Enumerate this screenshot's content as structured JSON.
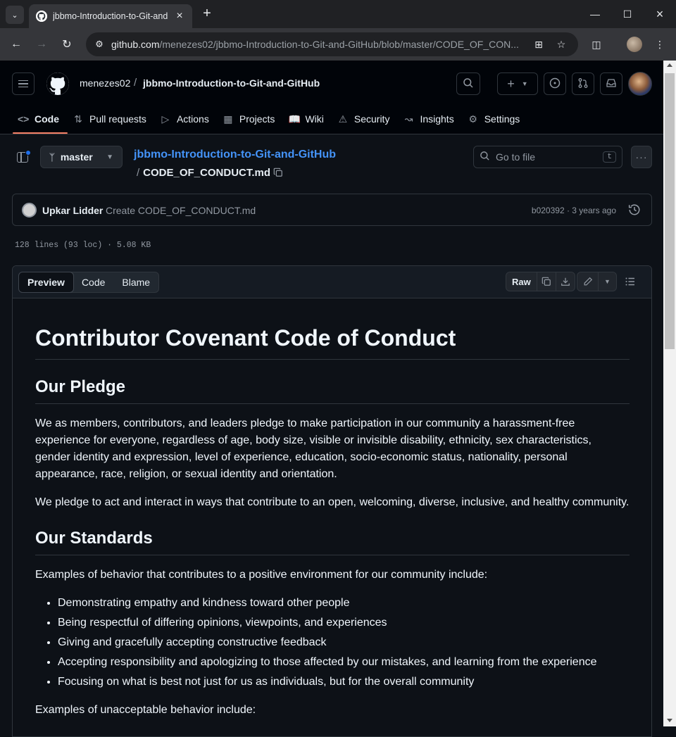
{
  "browser": {
    "tab_title": "jbbmo-Introduction-to-Git-and",
    "url_host": "github.com",
    "url_path": "/menezes02/jbbmo-Introduction-to-Git-and-GitHub/blob/master/CODE_OF_CON..."
  },
  "header": {
    "owner": "menezes02",
    "separator": "/",
    "repo": "jbbmo-Introduction-to-Git-and-GitHub"
  },
  "repo_nav": [
    {
      "label": "Code",
      "icon": "code-icon"
    },
    {
      "label": "Pull requests",
      "icon": "pull-request-icon"
    },
    {
      "label": "Actions",
      "icon": "actions-icon"
    },
    {
      "label": "Projects",
      "icon": "projects-icon"
    },
    {
      "label": "Wiki",
      "icon": "book-icon"
    },
    {
      "label": "Security",
      "icon": "shield-icon"
    },
    {
      "label": "Insights",
      "icon": "graph-icon"
    },
    {
      "label": "Settings",
      "icon": "gear-icon"
    }
  ],
  "file": {
    "branch": "master",
    "repo_link": "jbbmo-Introduction-to-Git-and-GitHub",
    "path_sep": "/",
    "filename": "CODE_OF_CONDUCT.md",
    "goto_placeholder": "Go to file",
    "goto_key": "t",
    "meta": "128 lines (93 loc) · 5.08 KB"
  },
  "commit": {
    "author": "Upkar Lidder",
    "message": "Create CODE_OF_CONDUCT.md",
    "sha_time": "b020392 · 3 years ago"
  },
  "viewer": {
    "tabs": [
      "Preview",
      "Code",
      "Blame"
    ],
    "raw_label": "Raw"
  },
  "content": {
    "h1": "Contributor Covenant Code of Conduct",
    "h2_pledge": "Our Pledge",
    "p1": "We as members, contributors, and leaders pledge to make participation in our community a harassment-free experience for everyone, regardless of age, body size, visible or invisible disability, ethnicity, sex characteristics, gender identity and expression, level of experience, education, socio-economic status, nationality, personal appearance, race, religion, or sexual identity and orientation.",
    "p2": "We pledge to act and interact in ways that contribute to an open, welcoming, diverse, inclusive, and healthy community.",
    "h2_standards": "Our Standards",
    "p3": "Examples of behavior that contributes to a positive environment for our community include:",
    "list": [
      "Demonstrating empathy and kindness toward other people",
      "Being respectful of differing opinions, viewpoints, and experiences",
      "Giving and gracefully accepting constructive feedback",
      "Accepting responsibility and apologizing to those affected by our mistakes, and learning from the experience",
      "Focusing on what is best not just for us as individuals, but for the overall community"
    ],
    "p4": "Examples of unacceptable behavior include:"
  }
}
